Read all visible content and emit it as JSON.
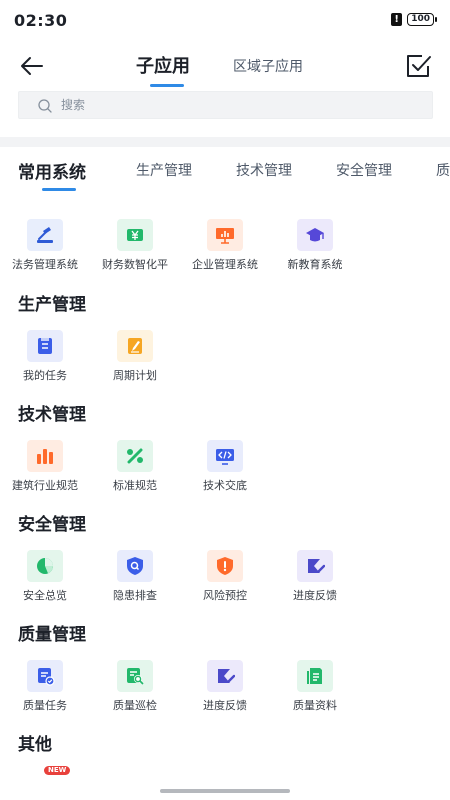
{
  "status_bar": {
    "time": "02:30",
    "battery": "100"
  },
  "nav": {
    "tab_active": "子应用",
    "tab_2": "区域子应用"
  },
  "search": {
    "placeholder": "搜索"
  },
  "categories": [
    "常用系统",
    "生产管理",
    "技术管理",
    "安全管理",
    "质"
  ],
  "sections": [
    {
      "title": "常用系统",
      "apps": [
        {
          "label": "法务管理系统",
          "icon": "gavel-icon",
          "color": "#2f5bd6",
          "bg": "#e8eefc"
        },
        {
          "label": "财务数智化平",
          "icon": "money-icon",
          "color": "#22b86b",
          "bg": "#e4f6ec"
        },
        {
          "label": "企业管理系统",
          "icon": "presentation-icon",
          "color": "#ff6a2b",
          "bg": "#ffece2"
        },
        {
          "label": "新教育系统",
          "icon": "graduation-cap-icon",
          "color": "#5648d8",
          "bg": "#ece9fb"
        }
      ]
    },
    {
      "title": "生产管理",
      "apps": [
        {
          "label": "我的任务",
          "icon": "task-icon",
          "color": "#3b5ee8",
          "bg": "#e8ecfc"
        },
        {
          "label": "周期计划",
          "icon": "plan-icon",
          "color": "#f6a623",
          "bg": "#fef3df"
        }
      ]
    },
    {
      "title": "技术管理",
      "apps": [
        {
          "label": "建筑行业规范",
          "icon": "bar-chart-icon",
          "color": "#ff6a2b",
          "bg": "#ffece2"
        },
        {
          "label": "标准规范",
          "icon": "percent-icon",
          "color": "#22b86b",
          "bg": "#e4f6ec"
        },
        {
          "label": "技术交底",
          "icon": "code-icon",
          "color": "#3b5ee8",
          "bg": "#e8ecfc"
        }
      ]
    },
    {
      "title": "安全管理",
      "apps": [
        {
          "label": "安全总览",
          "icon": "pie-chart-icon",
          "color": "#22b86b",
          "bg": "#e4f6ec"
        },
        {
          "label": "隐患排查",
          "icon": "shield-search-icon",
          "color": "#3b5ee8",
          "bg": "#e8ecfc"
        },
        {
          "label": "风险预控",
          "icon": "alert-shield-icon",
          "color": "#ff6a2b",
          "bg": "#ffece2"
        },
        {
          "label": "进度反馈",
          "icon": "hourglass-icon",
          "color": "#4b49c9",
          "bg": "#ece9fb"
        }
      ]
    },
    {
      "title": "质量管理",
      "apps": [
        {
          "label": "质量任务",
          "icon": "quality-task-icon",
          "color": "#3b5ee8",
          "bg": "#e8ecfc"
        },
        {
          "label": "质量巡检",
          "icon": "inspection-icon",
          "color": "#22b86b",
          "bg": "#e4f6ec"
        },
        {
          "label": "进度反馈",
          "icon": "hourglass-icon",
          "color": "#4b49c9",
          "bg": "#ece9fb"
        },
        {
          "label": "质量资料",
          "icon": "document-icon",
          "color": "#22b86b",
          "bg": "#e4f6ec"
        }
      ]
    },
    {
      "title": "其他",
      "apps": []
    }
  ],
  "badge": {
    "new": "NEW"
  }
}
